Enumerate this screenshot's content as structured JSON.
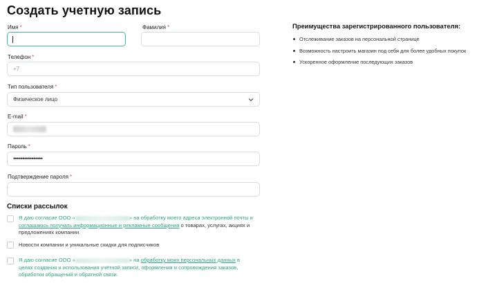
{
  "page": {
    "title": "Создать учетную запись"
  },
  "form": {
    "first_name": {
      "label": "Имя",
      "required": "*",
      "value": ""
    },
    "last_name": {
      "label": "Фамилия",
      "required": "*",
      "value": ""
    },
    "phone": {
      "label": "Телефон",
      "required": "*",
      "placeholder": "+7"
    },
    "user_type": {
      "label": "Тип пользователя",
      "required": "*",
      "value": "Физическое лицо"
    },
    "email": {
      "label": "E-mail",
      "required": "*"
    },
    "password": {
      "label": "Пароль",
      "required": "*",
      "value": "••••••••••••••••"
    },
    "confirm_password": {
      "label": "Подтверждение пароля",
      "required": "*",
      "value": ""
    }
  },
  "mailing": {
    "title": "Списки рассылок",
    "items": [
      {
        "part1": "Я даю согласие ООО «",
        "part2": "» на обработку моего адреса электронной почты и",
        "link": "соглашаюсь получать информационные и рекламные сообщения",
        "part3": " о товарах, услугах, акциях и предложениях компании."
      },
      {
        "text": "Новости компании и уникальные скидки для подписчиков"
      },
      {
        "part1": "Я даю согласие ООО «",
        "part2": "» на ",
        "link": "обработку моих персональных данных",
        "part3": " в целях создания и использования учётной записи, оформления и сопровождения заказов, обработки обращений и обратной связи."
      }
    ]
  },
  "benefits": {
    "title": "Преимущества зарегистрированного пользователя:",
    "items": [
      "Отслеживание заказов на персональной странице",
      "Возможность настроить магазин под себя для более удобных покупок",
      "Ускоренное оформление последующих заказов"
    ]
  },
  "colors": {
    "accent": "#2ba57f",
    "focus_border": "#3fb99a",
    "required": "#d9534f"
  },
  "icons": {
    "select_arrow": "chevron-down-icon"
  }
}
